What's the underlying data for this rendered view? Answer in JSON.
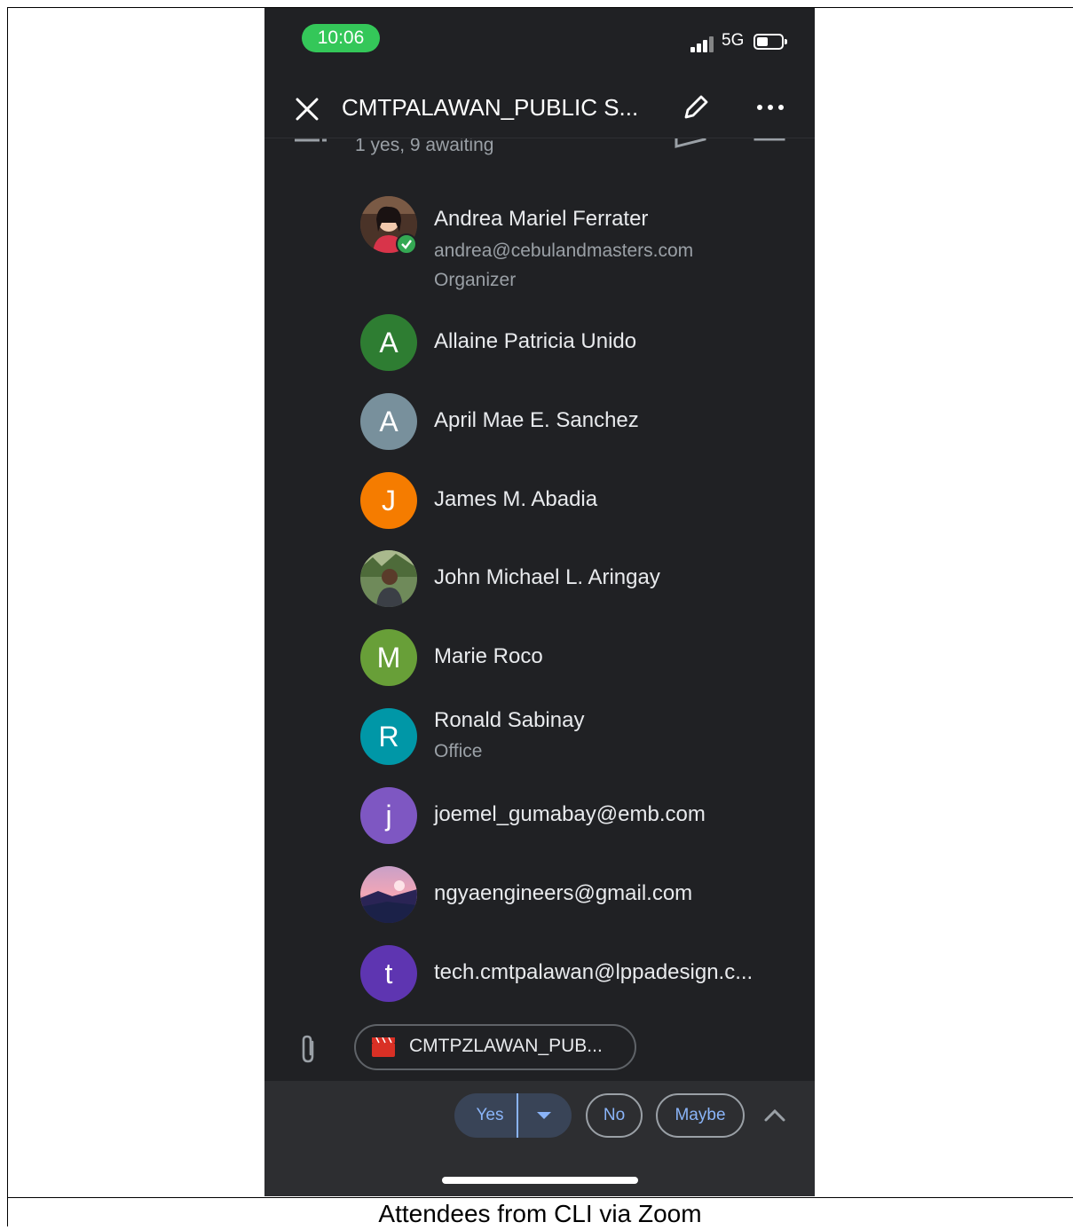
{
  "phone": {
    "status_bar": {
      "time": "10:06",
      "network": "5G"
    },
    "app_bar": {
      "title": "CMTPALAWAN_PUBLIC S..."
    },
    "rsvp_summary": "1 yes, 9 awaiting",
    "attendees": [
      {
        "name": "Andrea Mariel Ferrater",
        "email": "andrea@cebulandmasters.com",
        "role": "Organizer",
        "avatar": "photo",
        "status": "accepted-check"
      },
      {
        "name": "Allaine Patricia Unido",
        "initial": "A",
        "color": "#2e7d32"
      },
      {
        "name": "April Mae E. Sanchez",
        "initial": "A",
        "color": "#78909c"
      },
      {
        "name": "James M. Abadia",
        "initial": "J",
        "color": "#f57c00"
      },
      {
        "name": "John Michael L. Aringay",
        "avatar": "photo"
      },
      {
        "name": "Marie Roco",
        "initial": "M",
        "color": "#689f38"
      },
      {
        "name": "Ronald Sabinay",
        "detail": "Office",
        "initial": "R",
        "color": "#0097a7"
      },
      {
        "name": "joemel_gumabay@emb.com",
        "initial": "j",
        "color": "#7e57c2"
      },
      {
        "name": "ngyaengineers@gmail.com",
        "avatar": "photo"
      },
      {
        "name": "tech.cmtpalawan@lppadesign.c...",
        "initial": "t",
        "color": "#5e35b1"
      }
    ],
    "attachment": {
      "label": "CMTPZLAWAN_PUB...",
      "icon": "video-clapper-icon"
    },
    "response_bar": {
      "yes": "Yes",
      "no": "No",
      "maybe": "Maybe"
    },
    "colors": {
      "background": "#202124",
      "accent": "#8ab4f8",
      "time_pill": "#34c759"
    }
  },
  "caption": "Attendees from CLI via Zoom"
}
